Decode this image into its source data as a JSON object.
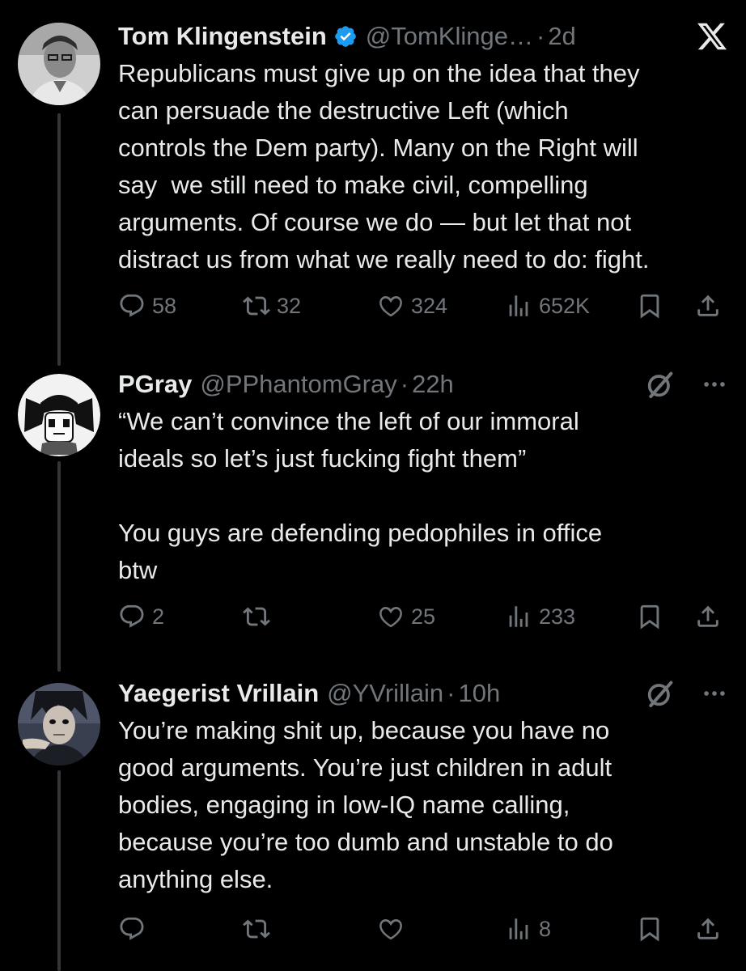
{
  "tweets": [
    {
      "name": "Tom Klingenstein",
      "handle": "@TomKlinge…",
      "dot": "·",
      "time": "2d",
      "text": "Republicans must give up on the idea that they\ncan persuade the destructive Left (which\ncontrols the Dem party). Many on the Right will\nsay  we still need to make civil, compelling\narguments. Of course we do — but let that not\ndistract us from what we really need to do: fight.",
      "replies": "58",
      "reposts": "32",
      "likes": "324",
      "views": "652K",
      "header_icon": "x-logo-icon"
    },
    {
      "name": "PGray",
      "handle": "@PPhantomGray",
      "dot": "·",
      "time": "22h",
      "text": "“We can’t convince the left of our immoral\nideals so let’s just fucking fight them”\n\nYou guys are defending pedophiles in office\nbtw",
      "replies": "2",
      "reposts": "",
      "likes": "25",
      "views": "233",
      "header_icon": "grok-icon"
    },
    {
      "name": "Yaegerist Vrillain",
      "handle": "@YVrillain",
      "dot": "·",
      "time": "10h",
      "text": "You’re making shit up, because you have no\ngood arguments. You’re just children in adult\nbodies, engaging in low-IQ name calling,\nbecause you’re too dumb and unstable to do\nanything else.",
      "replies": "",
      "reposts": "",
      "likes": "",
      "views": "8",
      "header_icon": "grok-icon"
    }
  ],
  "colors": {
    "background": "#000000",
    "text": "#e7e9ea",
    "muted": "#71767b",
    "verified": "#1d9bf0",
    "thread_line": "#333639"
  }
}
